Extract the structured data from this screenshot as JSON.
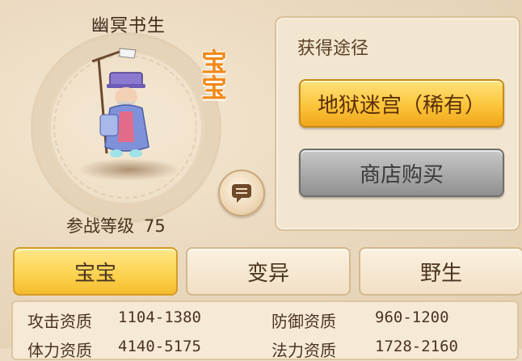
{
  "pet": {
    "name": "幽冥书生",
    "type_badge": "宝宝",
    "battle_level_label": "参战等级",
    "battle_level_value": "75"
  },
  "source": {
    "title": "获得途径",
    "options": [
      {
        "label": "地狱迷宫（稀有）"
      },
      {
        "label": "商店购买"
      }
    ]
  },
  "tabs": [
    {
      "label": "宝宝",
      "active": true
    },
    {
      "label": "变异",
      "active": false
    },
    {
      "label": "野生",
      "active": false
    }
  ],
  "stats": [
    {
      "label": "攻击资质",
      "value": "1104-1380"
    },
    {
      "label": "防御资质",
      "value": "960-1200"
    },
    {
      "label": "体力资质",
      "value": "4140-5175"
    },
    {
      "label": "法力资质",
      "value": "1728-2160"
    }
  ],
  "icons": {
    "chat": "chat-bubble-icon"
  },
  "colors": {
    "accent_gold": "#fcc53a",
    "badge_orange": "#f08a1a",
    "button_gray": "#a9a9a9"
  }
}
